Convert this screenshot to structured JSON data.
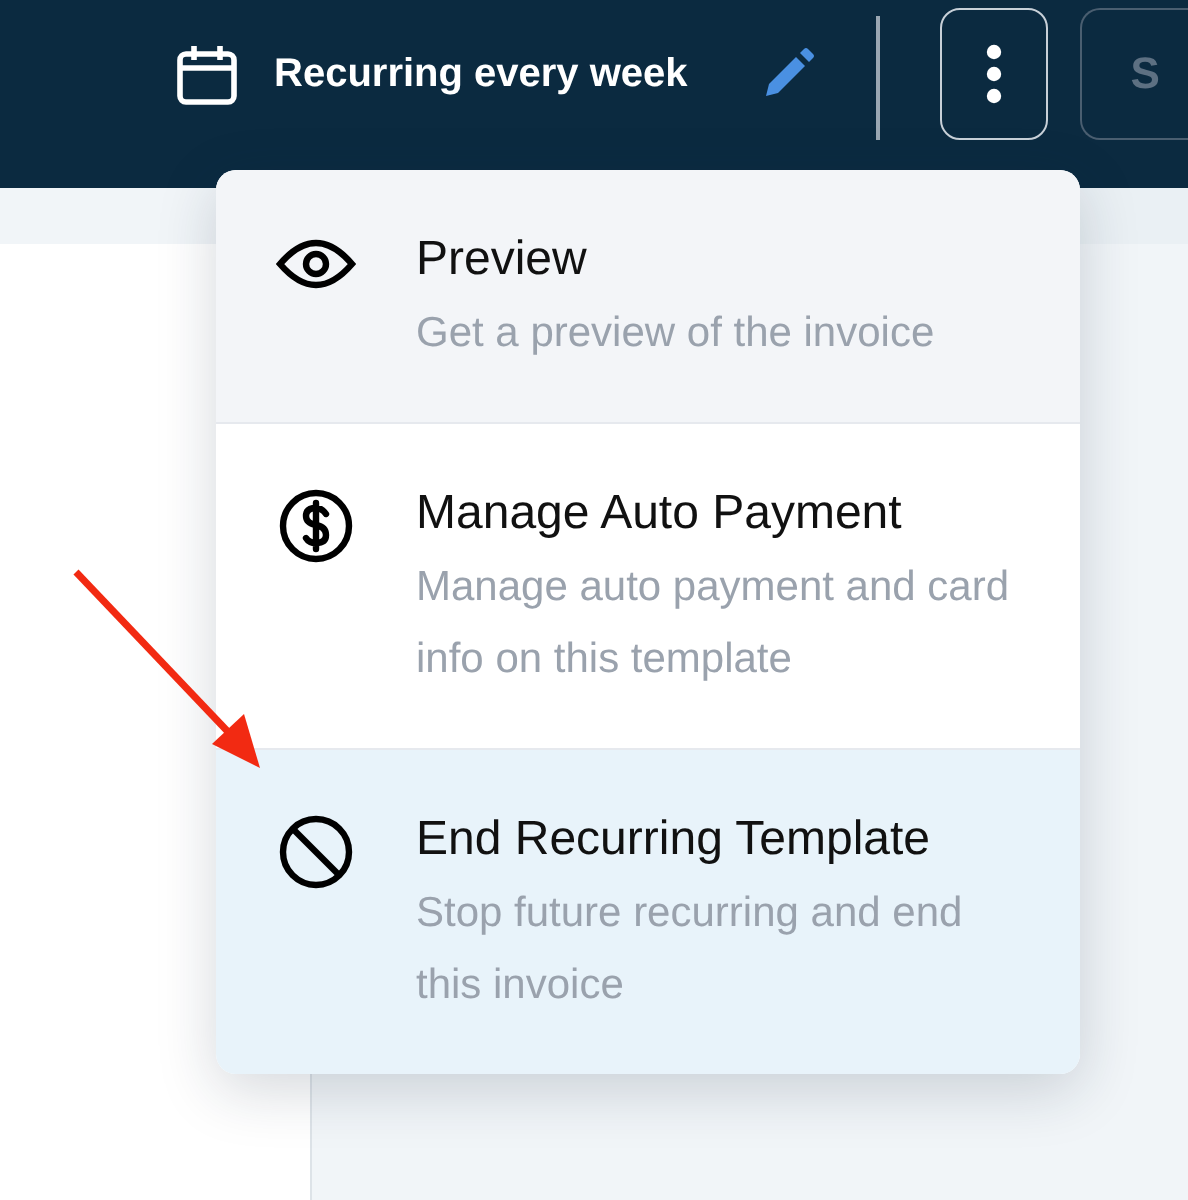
{
  "top_bar": {
    "schedule": "Recurring every week",
    "next_button": {
      "label": "S"
    }
  },
  "actions_menu": {
    "expanded": true,
    "items": [
      {
        "kind": "preview",
        "title": "Preview",
        "description": "Get a preview of the invoice",
        "hovered": true,
        "selected": false
      },
      {
        "kind": "payment",
        "title": "Manage Auto Payment",
        "description": "Manage auto payment and card info on this template",
        "hovered": false,
        "selected": false
      },
      {
        "kind": "end",
        "title": "End Recurring Template",
        "description": "Stop future recurring and end this invoice",
        "hovered": false,
        "selected": true
      }
    ]
  },
  "annotation": {
    "kind": "arrow"
  }
}
